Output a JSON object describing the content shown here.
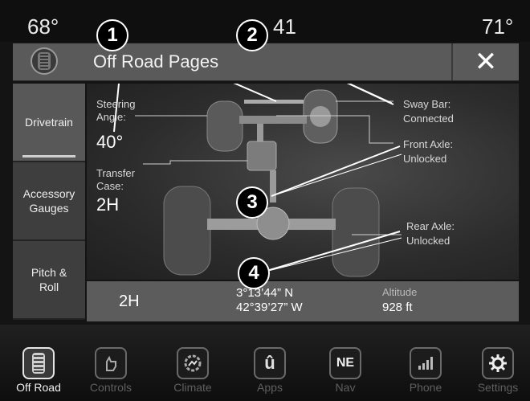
{
  "status": {
    "temp_left": "68°",
    "center": "41",
    "temp_right": "71°"
  },
  "titlebar": {
    "title": "Off Road Pages",
    "close_label": "✕"
  },
  "tabs": [
    {
      "label": "Drivetrain",
      "active": true
    },
    {
      "label": "Accessory Gauges",
      "active": false
    },
    {
      "label": "Pitch & Roll",
      "active": false
    }
  ],
  "gauges": {
    "steering_label": "Steering Angle:",
    "steering_value": "40°",
    "transfer_label": "Transfer Case:",
    "transfer_value": "2H",
    "sway_label": "Sway Bar:",
    "sway_value": "Connected",
    "front_label": "Front Axle:",
    "front_value": "Unlocked",
    "rear_label": "Rear Axle:",
    "rear_value": "Unlocked"
  },
  "strip": {
    "mode": "2H",
    "lat": "3°13’44” N",
    "lon": "42°39’27” W",
    "altitude_label": "Altitude",
    "altitude_value": "928 ft"
  },
  "callouts": [
    "1",
    "2",
    "3",
    "4"
  ],
  "nav": [
    {
      "label": "Off Road",
      "icon": "tire-tread-icon",
      "active": true
    },
    {
      "label": "Controls",
      "icon": "controls-hand-icon",
      "active": false
    },
    {
      "label": "Climate",
      "icon": "climate-icon",
      "active": false
    },
    {
      "label": "Apps",
      "icon": "apps-icon",
      "active": false
    },
    {
      "label": "Nav",
      "icon": "compass-ne-icon",
      "active": false
    },
    {
      "label": "Phone",
      "icon": "phone-signal-icon",
      "active": false
    },
    {
      "label": "Settings",
      "icon": "gear-icon",
      "active": false
    }
  ],
  "nav_compass_text": "NE"
}
